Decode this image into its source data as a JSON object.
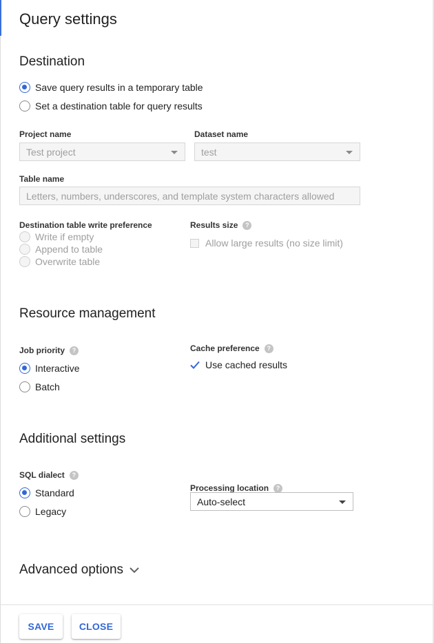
{
  "title": "Query settings",
  "destination": {
    "heading": "Destination",
    "radios": [
      {
        "label": "Save query results in a temporary table",
        "selected": true
      },
      {
        "label": "Set a destination table for query results",
        "selected": false
      }
    ],
    "project_label": "Project name",
    "project_value": "Test project",
    "dataset_label": "Dataset name",
    "dataset_value": "test",
    "table_label": "Table name",
    "table_placeholder": "Letters, numbers, underscores, and template system characters allowed",
    "write_pref_label": "Destination table write preference",
    "write_pref_options": [
      "Write if empty",
      "Append to table",
      "Overwrite table"
    ],
    "results_size_label": "Results size",
    "allow_large_label": "Allow large results (no size limit)"
  },
  "resource": {
    "heading": "Resource management",
    "job_priority_label": "Job priority",
    "job_priority_options": [
      {
        "label": "Interactive",
        "selected": true
      },
      {
        "label": "Batch",
        "selected": false
      }
    ],
    "cache_label": "Cache preference",
    "use_cached_label": "Use cached results",
    "use_cached_checked": true
  },
  "additional": {
    "heading": "Additional settings",
    "sql_dialect_label": "SQL dialect",
    "sql_dialect_options": [
      {
        "label": "Standard",
        "selected": true
      },
      {
        "label": "Legacy",
        "selected": false
      }
    ],
    "processing_location_label": "Processing location",
    "processing_location_value": "Auto-select"
  },
  "advanced": {
    "heading": "Advanced options"
  },
  "footer": {
    "save_label": "SAVE",
    "close_label": "CLOSE"
  },
  "colors": {
    "accent": "#3367d6",
    "disabled_text": "#9e9e9e"
  },
  "icons": {
    "help": "help-circle-icon",
    "dropdown": "caret-down-icon",
    "advanced_toggle": "chevron-down-icon",
    "checkbox_checked": "check-icon"
  }
}
